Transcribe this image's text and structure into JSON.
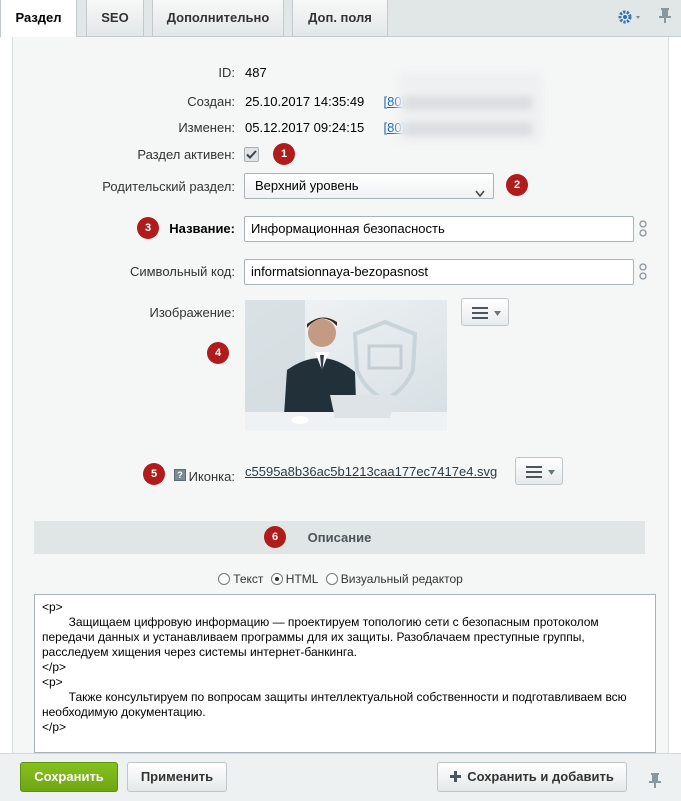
{
  "tabs": [
    {
      "label": "Раздел",
      "active": true
    },
    {
      "label": "SEO",
      "active": false
    },
    {
      "label": "Дополнительно",
      "active": false
    },
    {
      "label": "Доп. поля",
      "active": false
    }
  ],
  "icons": {
    "settings": "gear-icon",
    "pin": "pin-icon",
    "translit": "translit-icon",
    "menu": "menu-icon",
    "help": "help-icon",
    "plus": "plus-icon"
  },
  "fields": {
    "id_label": "ID:",
    "id_value": "487",
    "created_label": "Создан:",
    "created_value": "25.10.2017 14:35:49",
    "created_user": "[80]",
    "modified_label": "Изменен:",
    "modified_value": "05.12.2017 09:24:15",
    "modified_user": "[80]",
    "active_label": "Раздел активен:",
    "active_checked": true,
    "parent_label": "Родительский раздел:",
    "parent_value": "Верхний уровень",
    "name_label": "Название:",
    "name_value": "Информационная безопасность",
    "code_label": "Символьный код:",
    "code_value": "informatsionnaya-bezopasnost",
    "image_label": "Изображение:",
    "icon_label": "Иконка:",
    "icon_help": "?",
    "icon_file": "c5595a8b36ac5b1213caa177ec7417e4.svg"
  },
  "badges": [
    "1",
    "2",
    "3",
    "4",
    "5",
    "6"
  ],
  "description": {
    "title": "Описание",
    "modes": [
      {
        "label": "Текст",
        "selected": false
      },
      {
        "label": "HTML",
        "selected": true
      },
      {
        "label": "Визуальный редактор",
        "selected": false
      }
    ],
    "content": "<p>\n        Защищаем цифровую информацию — проектируем топологию сети с безопасным протоколом передачи данных и устанавливаем программы для их защиты. Разоблачаем преступные группы, расследуем хищения через системы интернет-банкинга.\n</p>\n<p>\n        Также консультируем по вопросам защиты интеллектуальной собственности и подготавливаем всю необходимую документацию.\n</p>"
  },
  "footer": {
    "save": "Сохранить",
    "apply": "Применить",
    "save_add": "Сохранить и добавить"
  },
  "colors": {
    "badge": "#b01b1b",
    "save_button": "#78b317",
    "link": "#2067b0"
  }
}
